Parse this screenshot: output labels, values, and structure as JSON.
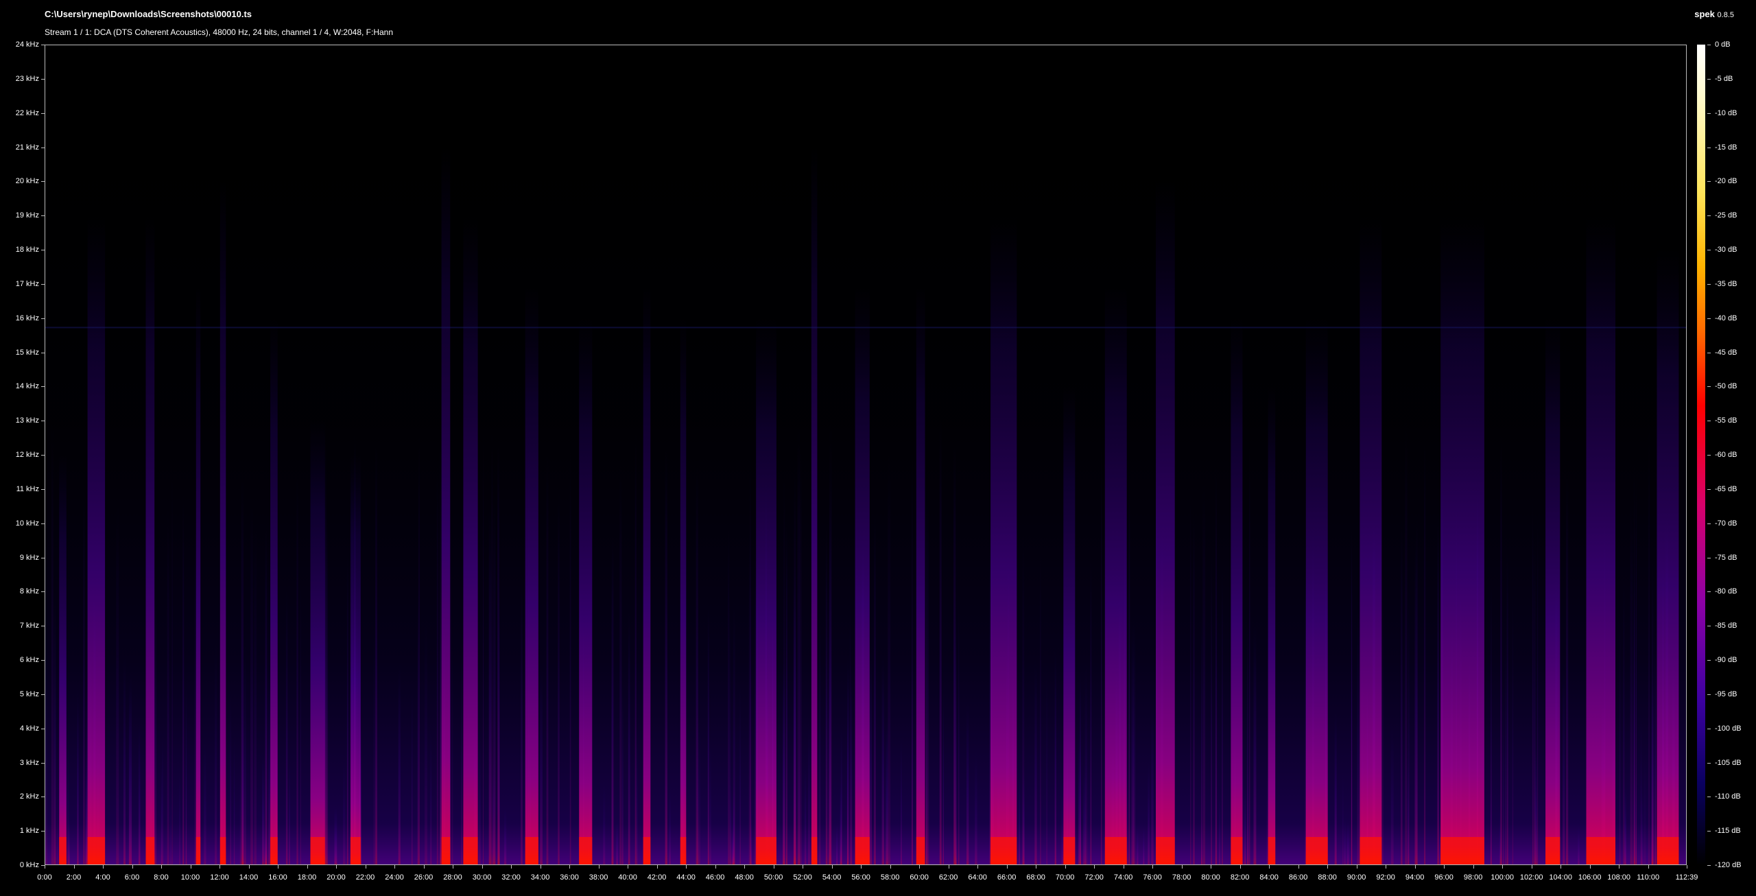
{
  "header": {
    "file_path": "C:\\Users\\rynep\\Downloads\\Screenshots\\00010.ts",
    "stream_info": "Stream 1 / 1: DCA (DTS Coherent Acoustics), 48000 Hz, 24 bits, channel 1 / 4, W:2048, F:Hann",
    "app_name": "spek",
    "app_version": "0.8.5"
  },
  "chart_data": {
    "type": "heatmap",
    "title": "",
    "xlabel": "",
    "ylabel": "",
    "x_range_seconds": [
      0,
      6759
    ],
    "y_range_khz": [
      0,
      24
    ],
    "db_range": [
      -120,
      0
    ],
    "y_ticks": [
      "0 kHz",
      "1 kHz",
      "2 kHz",
      "3 kHz",
      "4 kHz",
      "5 kHz",
      "6 kHz",
      "7 kHz",
      "8 kHz",
      "9 kHz",
      "10 kHz",
      "11 kHz",
      "12 kHz",
      "13 kHz",
      "14 kHz",
      "15 kHz",
      "16 kHz",
      "17 kHz",
      "18 kHz",
      "19 kHz",
      "20 kHz",
      "21 kHz",
      "22 kHz",
      "23 kHz",
      "24 kHz"
    ],
    "x_ticks": [
      "0:00",
      "2:00",
      "4:00",
      "6:00",
      "8:00",
      "10:00",
      "12:00",
      "14:00",
      "16:00",
      "18:00",
      "20:00",
      "22:00",
      "24:00",
      "26:00",
      "28:00",
      "30:00",
      "32:00",
      "34:00",
      "36:00",
      "38:00",
      "40:00",
      "42:00",
      "44:00",
      "46:00",
      "48:00",
      "50:00",
      "52:00",
      "54:00",
      "56:00",
      "58:00",
      "60:00",
      "62:00",
      "64:00",
      "66:00",
      "68:00",
      "70:00",
      "72:00",
      "74:00",
      "76:00",
      "78:00",
      "80:00",
      "82:00",
      "84:00",
      "86:00",
      "88:00",
      "90:00",
      "92:00",
      "94:00",
      "96:00",
      "98:00",
      "100:00",
      "102:00",
      "104:00",
      "106:00",
      "108:00",
      "110:00",
      "112:39"
    ],
    "db_ticks": [
      "0 dB",
      "-5 dB",
      "-10 dB",
      "-15 dB",
      "-20 dB",
      "-25 dB",
      "-30 dB",
      "-35 dB",
      "-40 dB",
      "-45 dB",
      "-50 dB",
      "-55 dB",
      "-60 dB",
      "-65 dB",
      "-70 dB",
      "-75 dB",
      "-80 dB",
      "-85 dB",
      "-90 dB",
      "-95 dB",
      "-100 dB",
      "-105 dB",
      "-110 dB",
      "-115 dB",
      "-120 dB"
    ],
    "colormap": [
      "#000000",
      "#0a0060",
      "#3c00a0",
      "#8d00a6",
      "#d8006a",
      "#ff0000",
      "#ff6a00",
      "#ffb300",
      "#ffe45a",
      "#fffbd0",
      "#ffffff"
    ],
    "loud_segments_minutes": [
      {
        "t": 1.2,
        "w": 0.5,
        "top_khz": 12
      },
      {
        "t": 3.5,
        "w": 1.2,
        "top_khz": 19
      },
      {
        "t": 7.2,
        "w": 0.6,
        "top_khz": 19
      },
      {
        "t": 10.5,
        "w": 0.3,
        "top_khz": 17
      },
      {
        "t": 12.2,
        "w": 0.4,
        "top_khz": 20
      },
      {
        "t": 15.7,
        "w": 0.5,
        "top_khz": 16
      },
      {
        "t": 18.7,
        "w": 1.0,
        "top_khz": 13
      },
      {
        "t": 21.3,
        "w": 0.7,
        "top_khz": 12
      },
      {
        "t": 27.5,
        "w": 0.6,
        "top_khz": 21
      },
      {
        "t": 29.2,
        "w": 1.0,
        "top_khz": 19
      },
      {
        "t": 33.4,
        "w": 0.9,
        "top_khz": 17
      },
      {
        "t": 37.1,
        "w": 0.9,
        "top_khz": 16
      },
      {
        "t": 41.3,
        "w": 0.5,
        "top_khz": 17
      },
      {
        "t": 43.8,
        "w": 0.4,
        "top_khz": 16
      },
      {
        "t": 49.5,
        "w": 1.4,
        "top_khz": 16
      },
      {
        "t": 52.8,
        "w": 0.4,
        "top_khz": 21
      },
      {
        "t": 56.1,
        "w": 1.0,
        "top_khz": 17
      },
      {
        "t": 60.1,
        "w": 0.6,
        "top_khz": 17
      },
      {
        "t": 65.8,
        "w": 1.8,
        "top_khz": 19
      },
      {
        "t": 70.3,
        "w": 0.8,
        "top_khz": 14
      },
      {
        "t": 73.5,
        "w": 1.5,
        "top_khz": 17
      },
      {
        "t": 76.9,
        "w": 1.3,
        "top_khz": 20
      },
      {
        "t": 81.8,
        "w": 0.8,
        "top_khz": 16
      },
      {
        "t": 84.2,
        "w": 0.5,
        "top_khz": 14
      },
      {
        "t": 87.3,
        "w": 1.5,
        "top_khz": 16
      },
      {
        "t": 91.0,
        "w": 1.5,
        "top_khz": 19
      },
      {
        "t": 97.3,
        "w": 3.0,
        "top_khz": 19
      },
      {
        "t": 103.5,
        "w": 1.0,
        "top_khz": 16
      },
      {
        "t": 106.8,
        "w": 2.0,
        "top_khz": 19
      },
      {
        "t": 111.4,
        "w": 1.5,
        "top_khz": 18
      }
    ]
  }
}
